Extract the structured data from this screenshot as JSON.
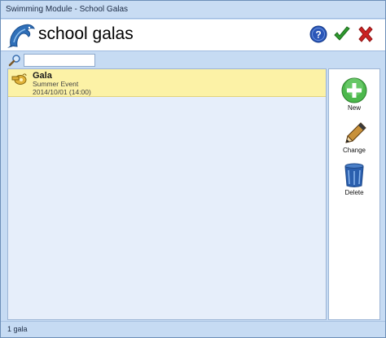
{
  "window": {
    "title": "Swimming Module - School Galas"
  },
  "header": {
    "title": "school galas",
    "logo_icon": "dolphin-icon",
    "help_icon": "help-icon",
    "ok_icon": "checkmark-icon",
    "cancel_icon": "close-x-icon"
  },
  "search": {
    "value": "",
    "placeholder": ""
  },
  "list": {
    "items": [
      {
        "icon": "whistle-icon",
        "title": "Gala",
        "subtitle": "Summer Event",
        "datetime": "2014/10/01 (14:00)"
      }
    ]
  },
  "actions": {
    "new_label": "New",
    "change_label": "Change",
    "delete_label": "Delete"
  },
  "status": {
    "text": "1 gala"
  },
  "colors": {
    "window_bg": "#c6dbf3",
    "selected_row": "#fcf2a6",
    "list_bg": "#e6eefa",
    "ok_green": "#2e9b2e",
    "cancel_red": "#cc2222",
    "help_blue": "#2a56b8"
  }
}
